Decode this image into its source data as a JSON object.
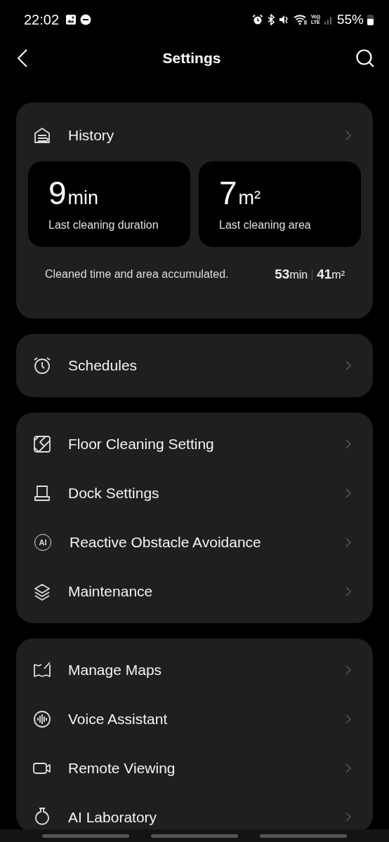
{
  "status_bar": {
    "time": "22:02",
    "network_label": [
      "Vo))",
      "LTE"
    ],
    "battery": "55%"
  },
  "header": {
    "title": "Settings"
  },
  "history": {
    "label": "History",
    "stats": [
      {
        "value": "9",
        "unit": "min",
        "caption": "Last cleaning duration"
      },
      {
        "value": "7",
        "unit": "m²",
        "caption": "Last cleaning area"
      }
    ],
    "summary": "Cleaned time and area accumulated.",
    "totals": [
      {
        "value": "53",
        "unit": "min"
      },
      {
        "value": "41",
        "unit": "m²"
      }
    ]
  },
  "groups": [
    {
      "items": [
        {
          "label": "Schedules",
          "kind": "alarm"
        }
      ]
    },
    {
      "items": [
        {
          "label": "Floor Cleaning Setting",
          "kind": "floor"
        },
        {
          "label": "Dock Settings",
          "kind": "dock"
        },
        {
          "label": "Reactive Obstacle Avoidance",
          "kind": "badge",
          "badge": "AI"
        },
        {
          "label": "Maintenance",
          "kind": "layers"
        }
      ]
    },
    {
      "items": [
        {
          "label": "Manage Maps",
          "kind": "map"
        },
        {
          "label": "Voice Assistant",
          "kind": "voice"
        },
        {
          "label": "Remote Viewing",
          "kind": "camera"
        },
        {
          "label": "AI Laboratory",
          "kind": "flask"
        }
      ]
    }
  ]
}
